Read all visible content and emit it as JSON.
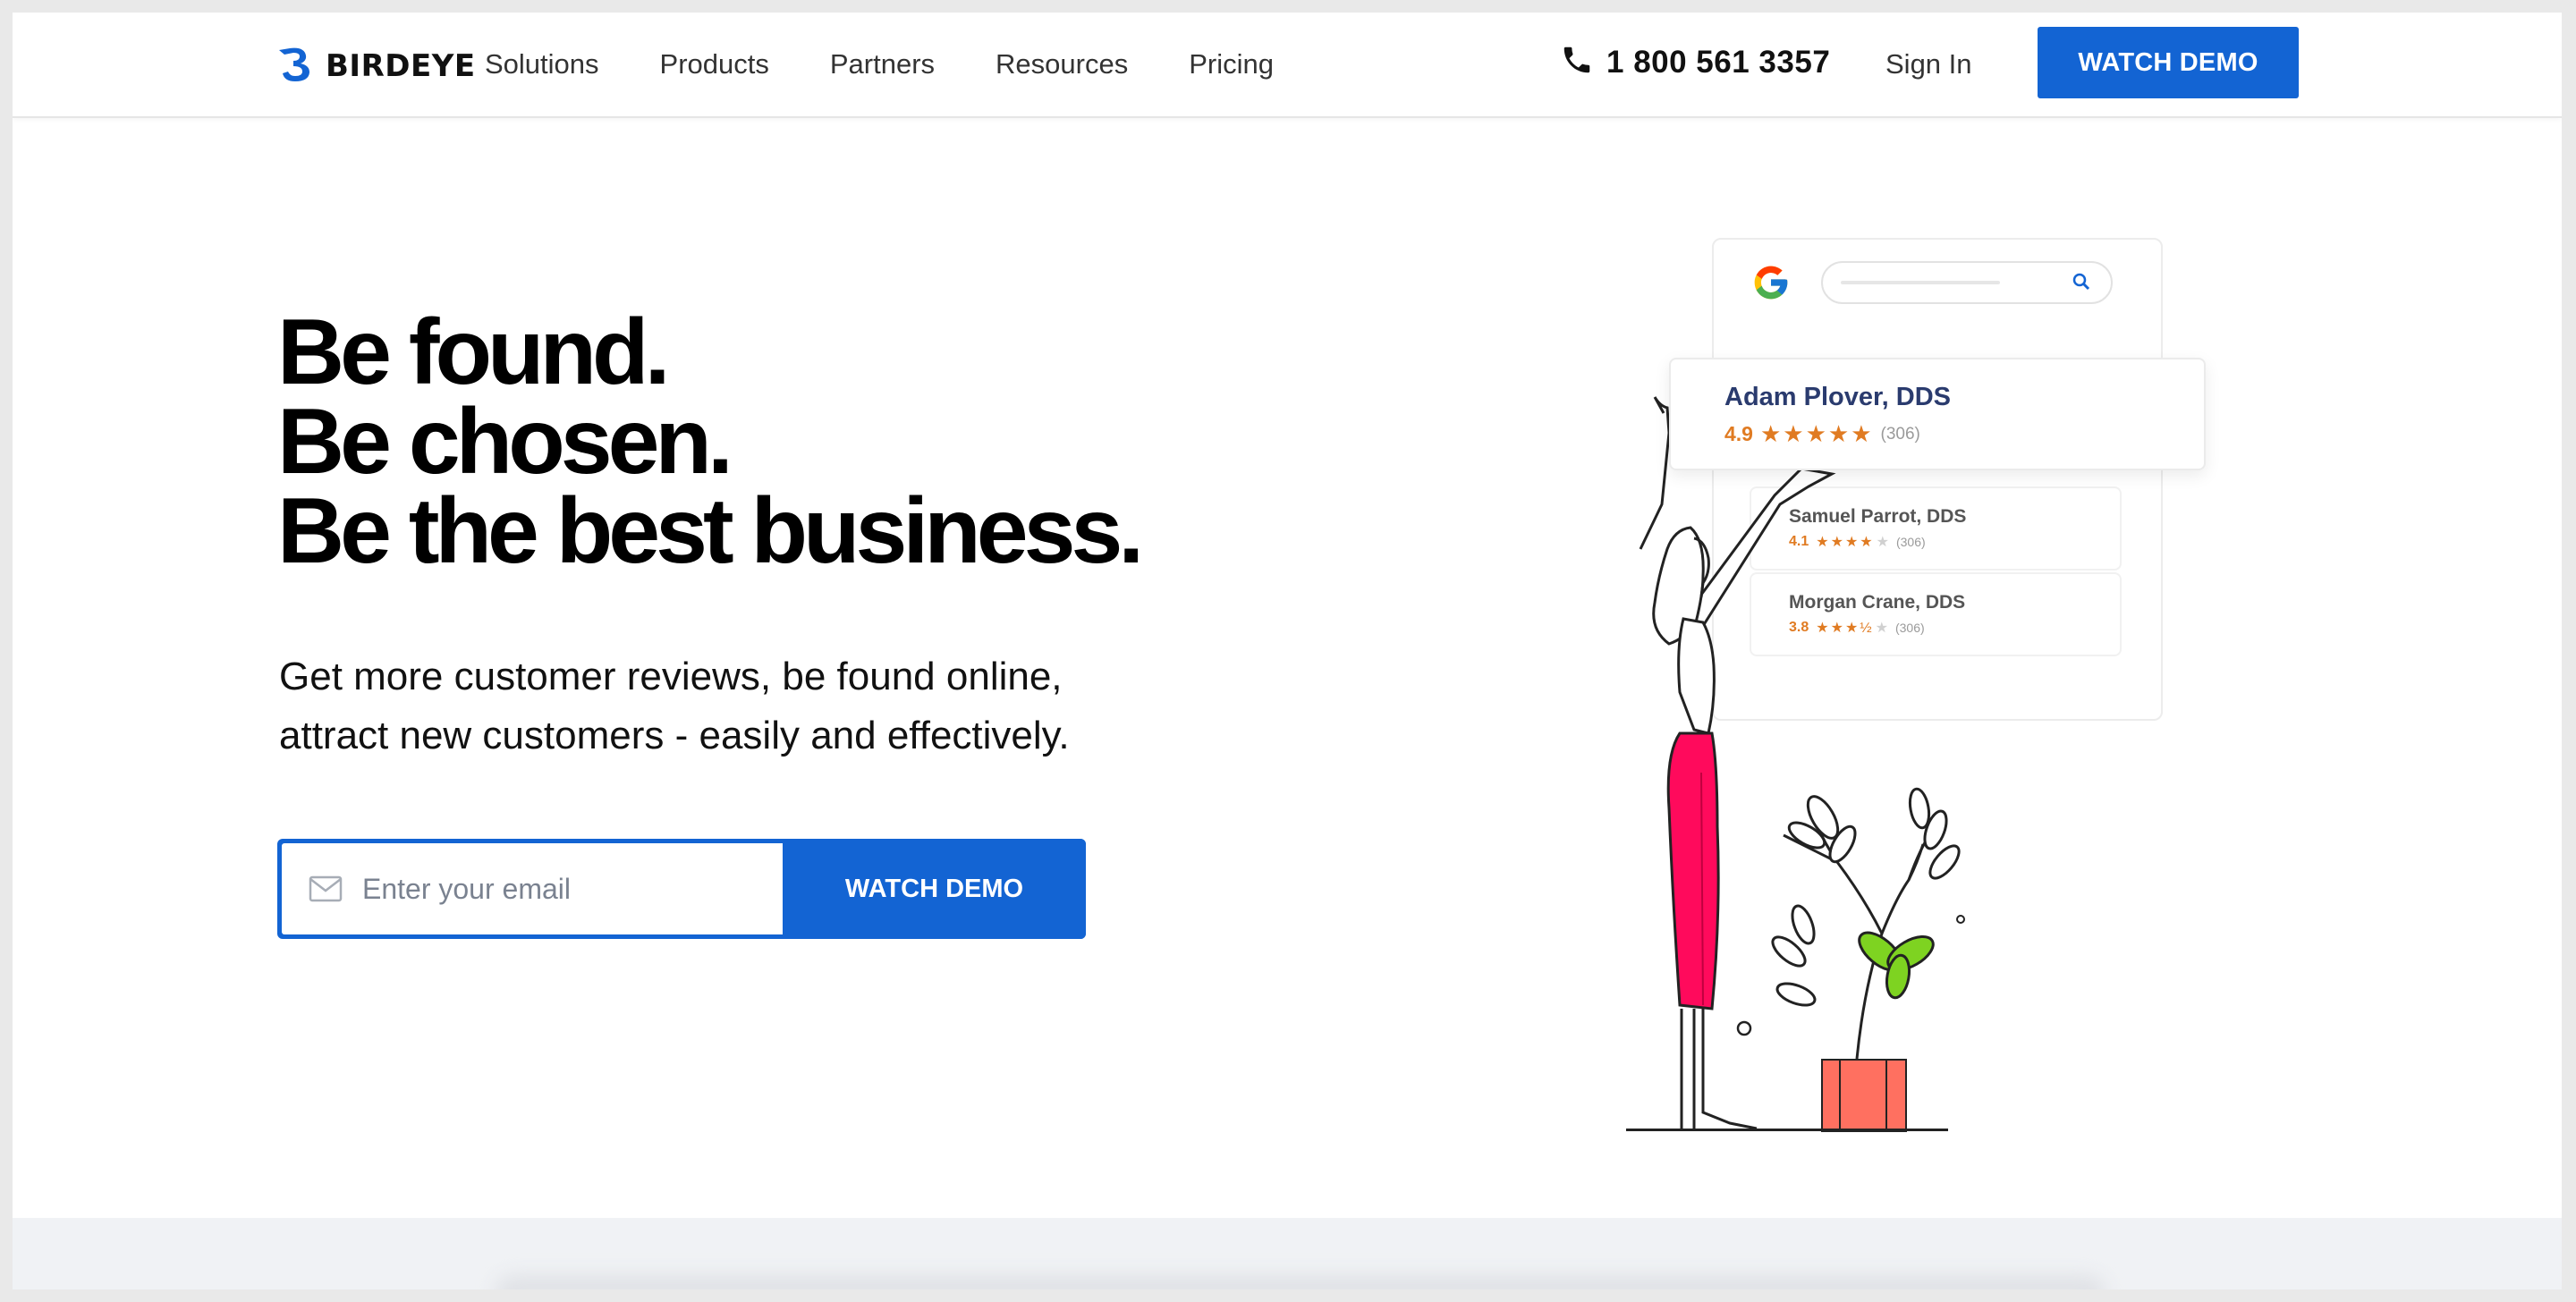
{
  "navbar": {
    "logo_text": "BIRDEYE",
    "links": [
      "Solutions",
      "Products",
      "Partners",
      "Resources",
      "Pricing"
    ],
    "phone": "1 800 561 3357",
    "signin": "Sign In",
    "cta": "WATCH DEMO"
  },
  "hero": {
    "headline": [
      "Be found.",
      "Be chosen.",
      "Be the best business."
    ],
    "subheadline_lines": [
      "Get more customer reviews, be found online,",
      "attract new customers - easily and effectively."
    ],
    "email_placeholder": "Enter your email",
    "cta": "WATCH DEMO"
  },
  "illustration": {
    "main_listing": {
      "name": "Adam Plover, DDS",
      "rating": "4.9",
      "stars": "★★★★★",
      "count": "(306)"
    },
    "listings": [
      {
        "name": "Samuel Parrot, DDS",
        "rating": "4.1",
        "stars": "★★★★",
        "empty": "★",
        "count": "(306)"
      },
      {
        "name": "Morgan Crane, DDS",
        "rating": "3.8",
        "stars": "★★★½",
        "empty": "★",
        "count": "(306)"
      }
    ]
  },
  "colors": {
    "brand_blue": "#1364d3",
    "star_orange": "#e07b22",
    "pants_pink": "#ff0a5c",
    "pot_coral": "#ff7060",
    "leaf_green": "#7ed321"
  },
  "icons": [
    "birdeye-logo-icon",
    "phone-icon",
    "mail-icon",
    "google-g-icon",
    "search-icon"
  ]
}
